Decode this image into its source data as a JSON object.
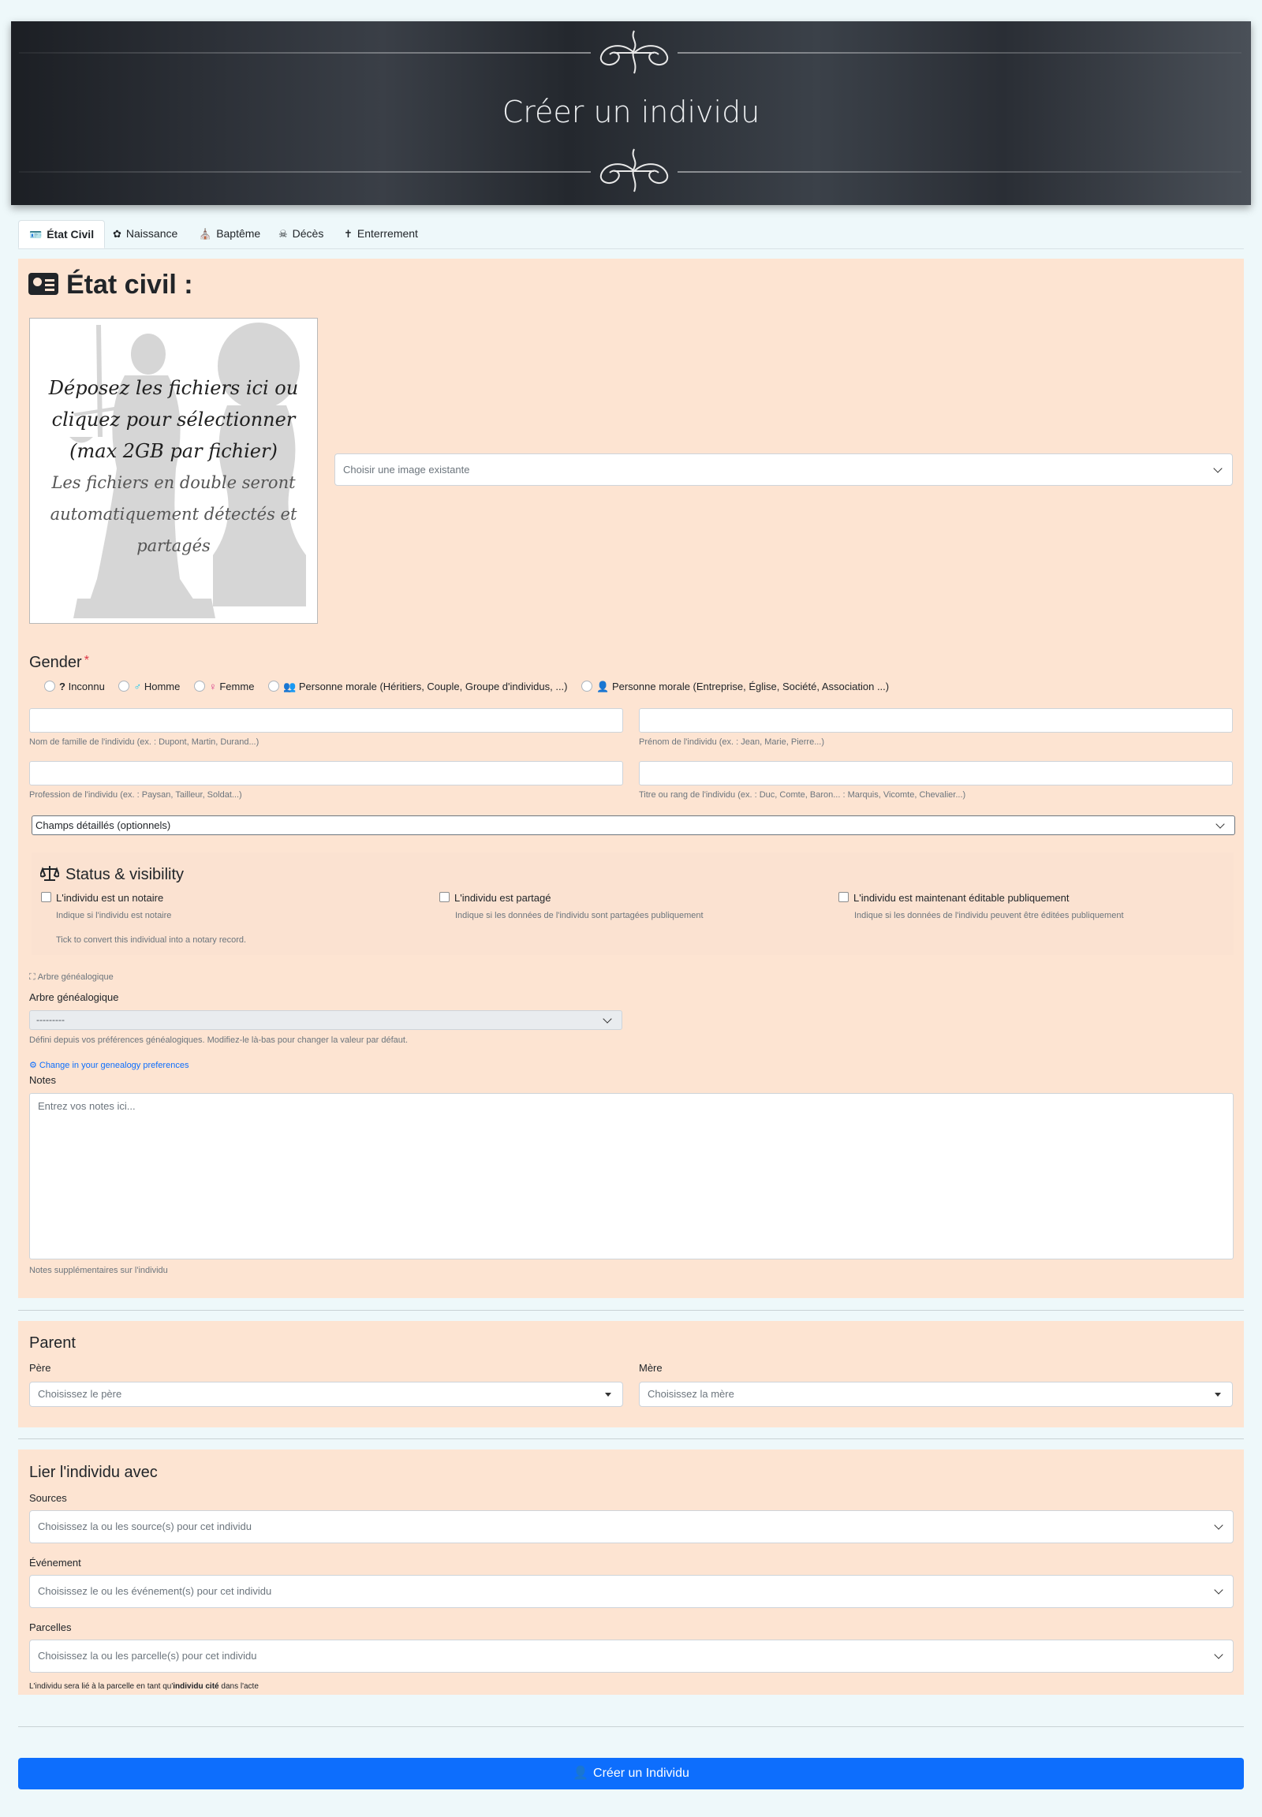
{
  "header": {
    "title": "Créer un individu"
  },
  "tabs": [
    {
      "label": "État Civil",
      "icon": "id-card-icon",
      "active": true
    },
    {
      "label": "Naissance",
      "icon": "baby-icon",
      "active": false
    },
    {
      "label": "Baptême",
      "icon": "church-icon",
      "active": false
    },
    {
      "label": "Décès",
      "icon": "skull-icon",
      "active": false
    },
    {
      "label": "Enterrement",
      "icon": "cross-icon",
      "active": false
    }
  ],
  "civil": {
    "heading": "État civil :",
    "dropzone": {
      "main": "Déposez les fichiers ici ou cliquez pour sélectionner (max 2GB par fichier)",
      "sub": "Les fichiers en double seront automatiquement détectés et partagés"
    },
    "image_select_placeholder": "Choisir une image existante",
    "gender": {
      "label": "Gender",
      "required_mark": "*",
      "options": [
        {
          "glyph": "?",
          "label": "Inconnu",
          "color": "#212529"
        },
        {
          "glyph": "♂",
          "label": "Homme",
          "color": "#0dcaf0"
        },
        {
          "glyph": "♀",
          "label": "Femme",
          "color": "#d63384"
        },
        {
          "glyph": "👥",
          "label": "Personne morale (Héritiers, Couple, Groupe d'individus, ...)",
          "color": "#0dcaf0"
        },
        {
          "glyph": "👤",
          "label": "Personne morale (Entreprise, Église, Société, Association ...)",
          "color": "#20c997"
        }
      ]
    },
    "fields": {
      "lastname_help": "Nom de famille de l'individu (ex. : Dupont, Martin, Durand...)",
      "firstname_help": "Prénom de l'individu (ex. : Jean, Marie, Pierre...)",
      "profession_help": "Profession de l'individu (ex. : Paysan, Tailleur, Soldat...)",
      "title_help": "Titre ou rang de l'individu (ex. : Duc, Comte, Baron... : Marquis, Vicomte, Chevalier...)"
    },
    "details_toggle": "Champs détaillés (optionnels)",
    "status": {
      "title": "Status & visibility",
      "items": [
        {
          "label": "L'individu est un notaire",
          "help": "Indique si l'individu est notaire",
          "extra": "Tick to convert this individual into a notary record."
        },
        {
          "label": "L'individu est partagé",
          "help": "Indique si les données de l'individu sont partagées publiquement"
        },
        {
          "label": "L'individu est maintenant éditable publiquement",
          "help": "Indique si les données de l'individu peuvent être éditées publiquement"
        }
      ]
    },
    "tree": {
      "small_label": "Arbre généalogique",
      "label": "Arbre généalogique",
      "value": "---------",
      "help": "Défini depuis vos préférences généalogiques. Modifiez-le là-bas pour changer la valeur par défaut.",
      "link": "Change in your genealogy preferences"
    },
    "notes": {
      "label": "Notes",
      "placeholder": "Entrez vos notes ici...",
      "help": "Notes supplémentaires sur l'individu"
    }
  },
  "parent": {
    "title": "Parent",
    "father_label": "Père",
    "father_placeholder": "Choisissez le père",
    "mother_label": "Mère",
    "mother_placeholder": "Choisissez la mère"
  },
  "link": {
    "title": "Lier l'individu avec",
    "sources_label": "Sources",
    "sources_placeholder": "Choisissez la ou les source(s) pour cet individu",
    "events_label": "Événement",
    "events_placeholder": "Choisissez le ou les événement(s) pour cet individu",
    "parcels_label": "Parcelles",
    "parcels_placeholder": "Choisissez la ou les parcelle(s) pour cet individu",
    "note_before": "L'individu sera lié à la parcelle en tant qu'",
    "note_bold": "individu cité",
    "note_after": " dans l'acte"
  },
  "submit": {
    "label": "Créer un Individu",
    "color": "#0d6efd"
  },
  "colors": {
    "panel": "#fde4d2",
    "page": "#eef8fa"
  }
}
